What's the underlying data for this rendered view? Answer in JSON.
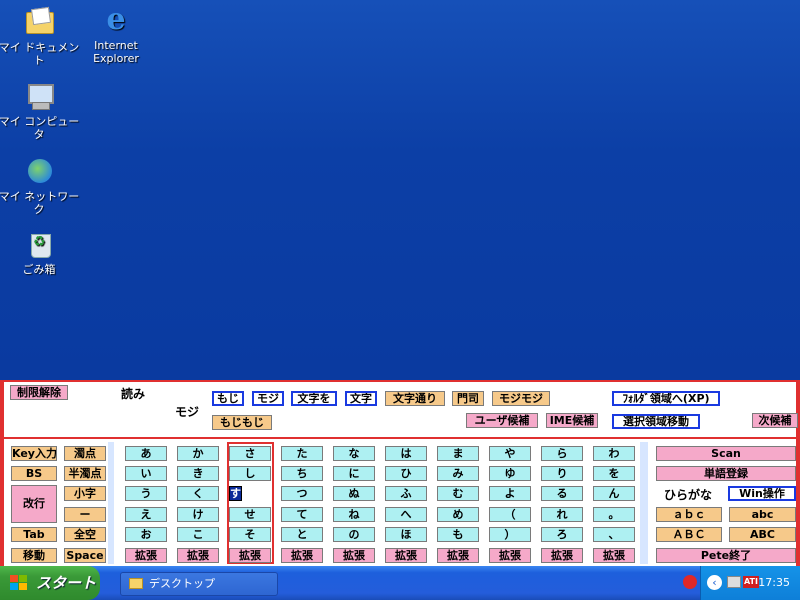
{
  "desktop": {
    "icons": [
      {
        "label": "マイ ドキュメント"
      },
      {
        "label_line1": "Internet",
        "label_line2": "Explorer"
      },
      {
        "label": "マイ コンピュータ"
      },
      {
        "label": "マイ ネットワーク"
      },
      {
        "label": "ごみ箱"
      }
    ]
  },
  "panel": {
    "release_button": "制限解除",
    "reading_label": "読み",
    "reading_value": "モジ",
    "candidates_row1": [
      "もじ",
      "モジ",
      "文字を",
      "文字",
      "文字通り",
      "門司",
      "モジモジ"
    ],
    "candidates_row2": [
      "もじもじ"
    ],
    "folder_button": "ﾌｫﾙﾀﾞ領域へ(XP)",
    "user_candidates": "ユーザ候補",
    "ime_candidates": "IME候補",
    "select_area_move": "選択領域移動",
    "next_candidates": "次候補",
    "left_keys": {
      "key_input": "Key入力",
      "dakuten": "濁点",
      "bs": "BS",
      "handakuten": "半濁点",
      "newline": "改行",
      "small": "小字",
      "dash": "ー",
      "tab": "Tab",
      "fullspace": "全空",
      "move": "移動",
      "space": "Space"
    },
    "kana_columns": [
      [
        "あ",
        "い",
        "う",
        "え",
        "お"
      ],
      [
        "か",
        "き",
        "く",
        "け",
        "こ"
      ],
      [
        "さ",
        "し",
        "す",
        "せ",
        "そ"
      ],
      [
        "た",
        "ち",
        "つ",
        "て",
        "と"
      ],
      [
        "な",
        "に",
        "ぬ",
        "ね",
        "の"
      ],
      [
        "は",
        "ひ",
        "ふ",
        "へ",
        "ほ"
      ],
      [
        "ま",
        "み",
        "む",
        "め",
        "も"
      ],
      [
        "や",
        "ゆ",
        "よ",
        "（",
        "）"
      ],
      [
        "ら",
        "り",
        "る",
        "れ",
        "ろ"
      ],
      [
        "わ",
        "を",
        "ん",
        "。",
        "、"
      ]
    ],
    "extend_label": "拡張",
    "selected_kana": "す",
    "right_keys": {
      "scan": "Scan",
      "word_register": "単語登録",
      "hiragana": "ひらがな",
      "win_operation": "Win操作",
      "abc_half": "ａｂｃ",
      "abc_lower": "abc",
      "abc_full_upper": "ＡＢＣ",
      "abc_upper": "ABC",
      "pete_exit": "Pete終了"
    }
  },
  "taskbar": {
    "start_label": "スタート",
    "task_desktop": "デスクトップ",
    "clock": "17:35"
  },
  "colors": {
    "desktop_bg": "#0c3fa6",
    "kana_key": "#aef0f2",
    "extend_key": "#f5a9c9",
    "orange_key": "#f6c98a",
    "selected_key": "#0a2a9a",
    "candidate_frame": "#1a3ae0"
  }
}
